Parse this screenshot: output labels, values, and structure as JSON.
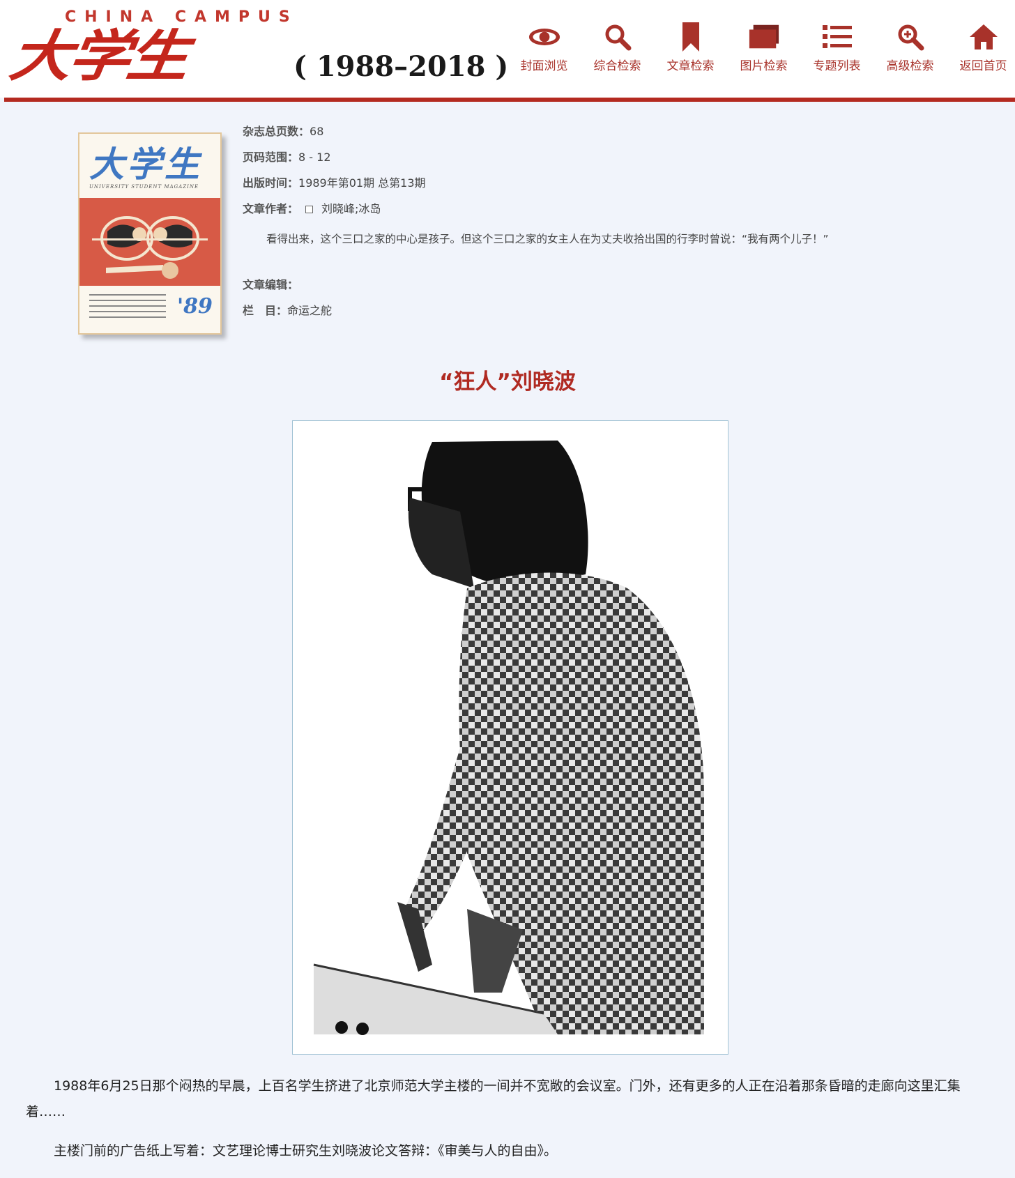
{
  "header": {
    "logo_en": "CHINA CAMPUS",
    "logo_cn": "大学生",
    "logo_years": "( 1988–2018 )",
    "nav": [
      {
        "label": "封面浏览",
        "icon": "eye-icon"
      },
      {
        "label": "综合检索",
        "icon": "search-icon"
      },
      {
        "label": "文章检索",
        "icon": "bookmark-icon"
      },
      {
        "label": "图片检索",
        "icon": "image-stack-icon"
      },
      {
        "label": "专题列表",
        "icon": "list-icon"
      },
      {
        "label": "高级检索",
        "icon": "advanced-search-icon"
      },
      {
        "label": "返回首页",
        "icon": "home-icon"
      }
    ],
    "accent_color": "#b42a20"
  },
  "cover": {
    "title": "大学生",
    "subtitle": "UNIVERSITY STUDENT MAGAZINE",
    "issue": "'89 1"
  },
  "meta": {
    "pages_label": "杂志总页数：",
    "pages_value": "68",
    "range_label": "页码范围：",
    "range_value": "8 - 12",
    "date_label": "出版时间：",
    "date_value": "1989年第01期 总第13期",
    "author_label": "文章作者：",
    "author_value": "刘晓峰;冰岛",
    "summary": "看得出来，这个三口之家的中心是孩子。但这个三口之家的女主人在为丈夫收拾出国的行李时曾说：“我有两个儿子！”",
    "editor_label": "文章编辑：",
    "editor_value": "",
    "column_label": "栏　目：",
    "column_value": "命运之舵"
  },
  "article": {
    "title": "“狂人”刘晓波",
    "paragraphs": [
      "1988年6月25日那个闷热的早晨，上百名学生挤进了北京师范大学主楼的一间并不宽敞的会议室。门外，还有更多的人正在沿着那条昏暗的走廊向这里汇集着……",
      "主楼门前的广告纸上写着：文艺理论博士研究生刘晓波论文答辩：《审美与人的自由》。"
    ]
  }
}
